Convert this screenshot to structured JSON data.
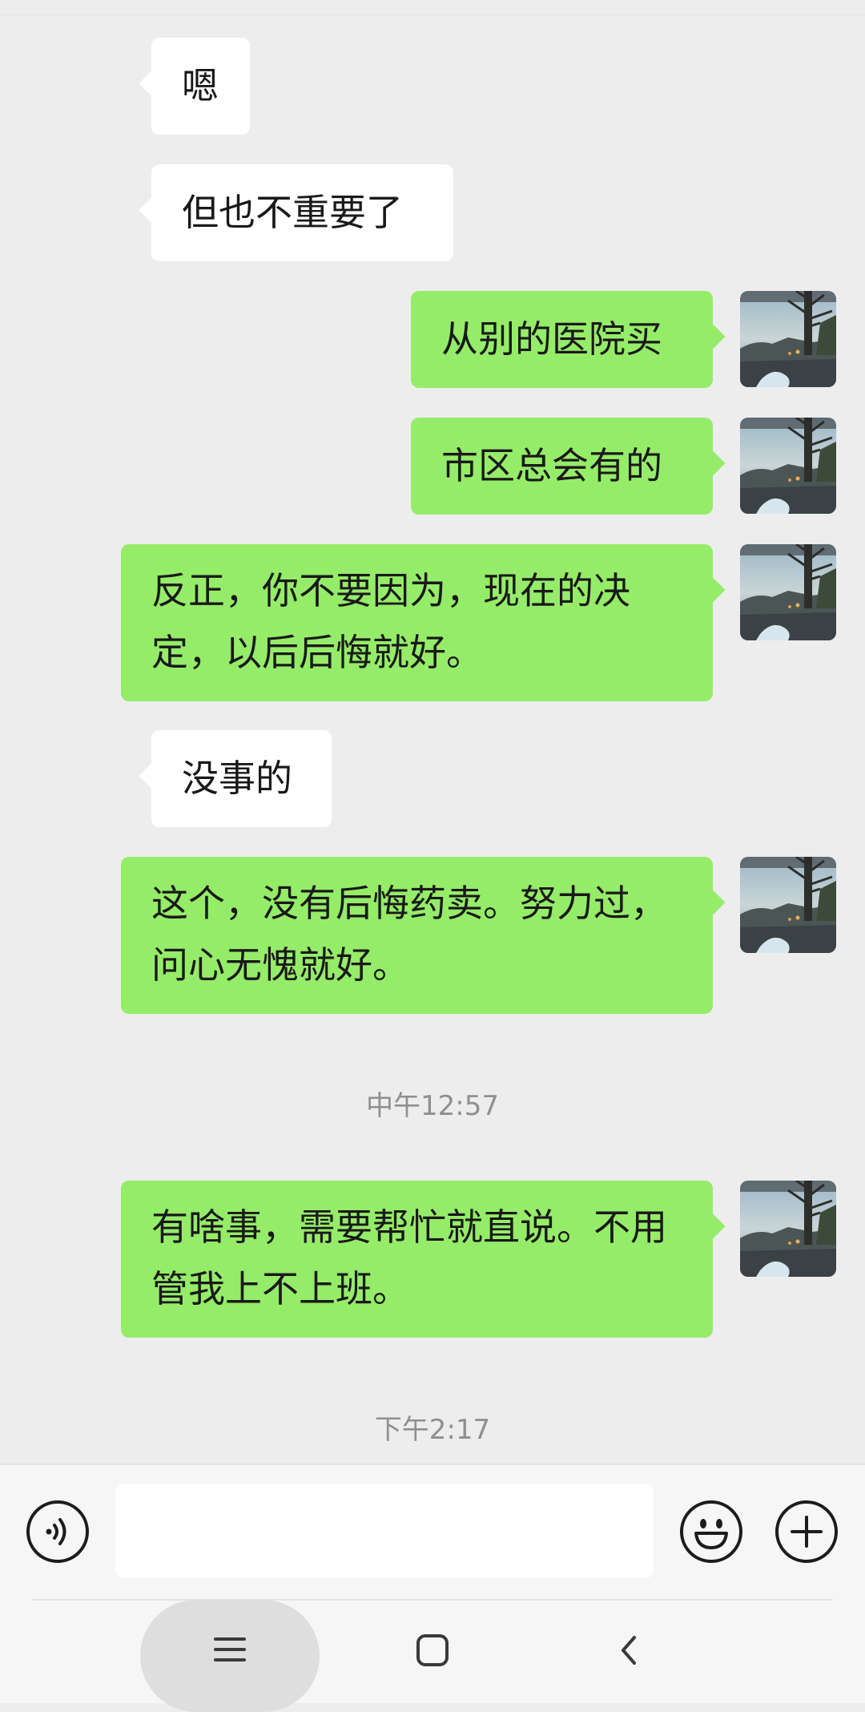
{
  "messages": [
    {
      "text": "嗯",
      "side": "in"
    },
    {
      "text": "但也不重要了",
      "side": "in"
    },
    {
      "text": "从别的医院买",
      "side": "out"
    },
    {
      "text": "市区总会有的",
      "side": "out"
    },
    {
      "text": "反正，你不要因为，现在的决定，以后后悔就好。",
      "side": "out"
    },
    {
      "text": "没事的",
      "side": "in"
    },
    {
      "text": "这个，没有后悔药卖。努力过，问心无愧就好。",
      "side": "out"
    },
    {
      "text": "有啥事，需要帮忙就直说。不用管我上不上班。",
      "side": "out"
    }
  ],
  "timestamps": [
    "中午12:57",
    "下午2:17"
  ],
  "input": {
    "value": "",
    "placeholder": ""
  },
  "icons": {
    "voice": "voice-icon",
    "emoji": "emoji-icon",
    "add": "plus-icon",
    "nav_menu": "menu-icon",
    "nav_home": "home-icon",
    "nav_back": "back-icon"
  },
  "colors": {
    "background": "#ededed",
    "bubble_out": "#95ec69",
    "bubble_in": "#ffffff",
    "timestamp": "#8f8f8f",
    "text": "#191919"
  }
}
